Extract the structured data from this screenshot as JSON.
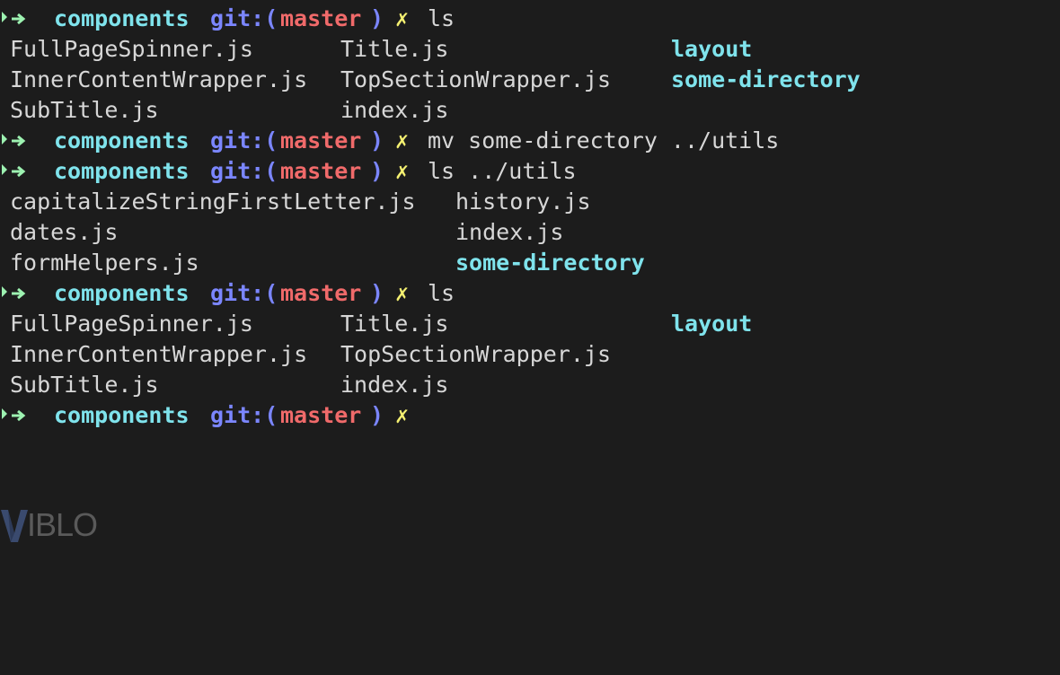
{
  "terminal": {
    "prompt": {
      "directory": "components",
      "git_label": "git:(",
      "branch": "master",
      "git_close": ")",
      "dirty_marker": "✗"
    },
    "commands": {
      "c1": "ls",
      "c2": "mv some-directory ../utils",
      "c3": "ls ../utils",
      "c4": "ls",
      "c5": ""
    },
    "listing1": {
      "col1": [
        "FullPageSpinner.js",
        "InnerContentWrapper.js",
        "SubTitle.js"
      ],
      "col2": [
        "Title.js",
        "TopSectionWrapper.js",
        "index.js"
      ],
      "col3": [
        "layout",
        "some-directory"
      ]
    },
    "listing2": {
      "col1": [
        "capitalizeStringFirstLetter.js",
        "dates.js",
        "formHelpers.js"
      ],
      "col2": [
        "history.js",
        "index.js",
        "some-directory"
      ]
    },
    "listing3": {
      "col1": [
        "FullPageSpinner.js",
        "InnerContentWrapper.js",
        "SubTitle.js"
      ],
      "col2": [
        "Title.js",
        "TopSectionWrapper.js",
        "index.js"
      ],
      "col3": [
        "layout"
      ]
    }
  },
  "watermark": {
    "text": "IBLO",
    "icon": "viblo-v-logo-icon"
  },
  "colors": {
    "background": "#1c1c1c",
    "directory": "#7fe3ec",
    "git": "#7b86ff",
    "branch": "#f06a6a",
    "dirty": "#f4f071",
    "arrow": "#9df2b1",
    "text": "#d7d7d7"
  }
}
